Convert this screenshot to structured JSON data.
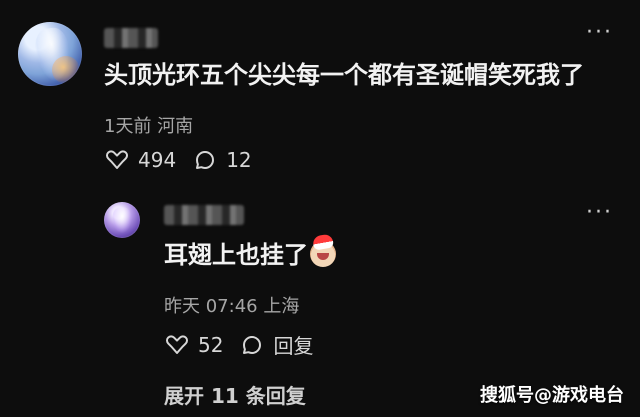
{
  "comment": {
    "text": "头顶光环五个尖尖每一个都有圣诞帽笑死我了",
    "meta": "1天前 河南",
    "likes": "494",
    "replies": "12"
  },
  "reply": {
    "text": "耳翅上也挂了",
    "emoji": "crying-laughing-santa-hat-emoji",
    "meta": "昨天 07:46 上海",
    "likes": "52",
    "reply_label": "回复"
  },
  "expand": {
    "label": "展开 11 条回复"
  },
  "watermark": {
    "text": "搜狐号@游戏电台"
  },
  "icons": {
    "more": "more-icon",
    "like": "heart-icon",
    "comment": "comment-icon"
  },
  "colors": {
    "background": "#0d0d0d",
    "text": "#f2f2f2",
    "meta": "#a6a6a6",
    "icon": "#d7d7d7"
  }
}
